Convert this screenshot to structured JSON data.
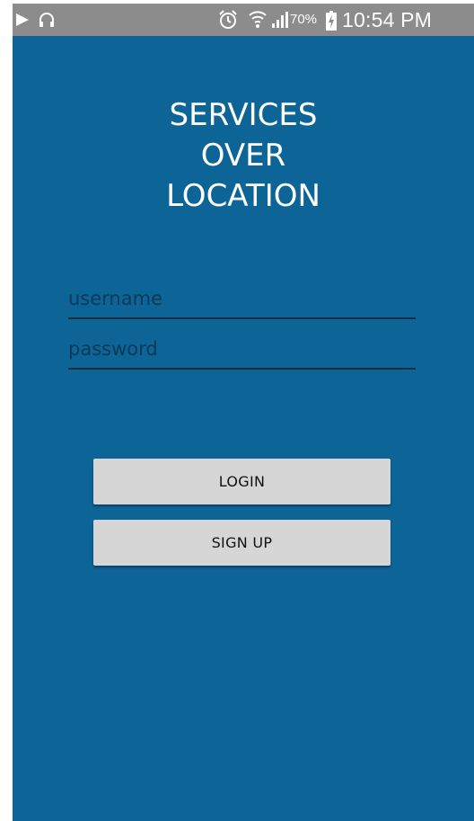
{
  "status_bar": {
    "battery_percent": "70%",
    "time": "10:54 PM",
    "icons": [
      "play-icon",
      "headphones-icon",
      "alarm-icon",
      "wifi-icon",
      "signal-icon",
      "battery-charging-icon"
    ]
  },
  "app": {
    "title_lines": [
      "SERVICES",
      "OVER",
      "LOCATION"
    ]
  },
  "form": {
    "username_placeholder": "username",
    "username_value": "",
    "password_placeholder": "password",
    "password_value": "",
    "login_label": "LOGIN",
    "signup_label": "SIGN UP"
  },
  "colors": {
    "background": "#0c6497",
    "status_bar": "#8c8c8c",
    "button": "#d6d6d6",
    "field_text": "#0a3a58"
  }
}
